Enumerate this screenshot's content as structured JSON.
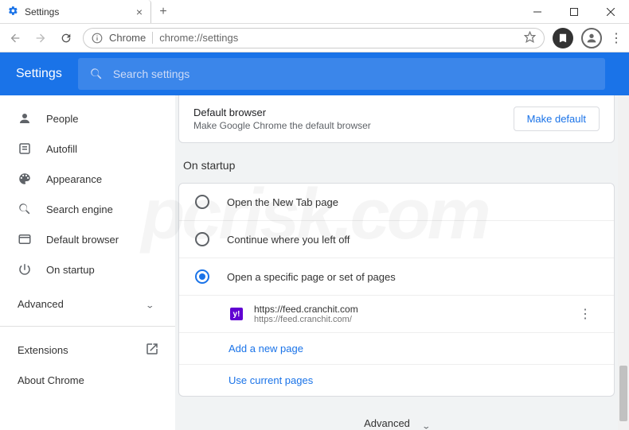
{
  "window": {
    "tab_title": "Settings",
    "new_tab": "+"
  },
  "addressbar": {
    "chrome_label": "Chrome",
    "url": "chrome://settings"
  },
  "header": {
    "title": "Settings",
    "search_placeholder": "Search settings"
  },
  "sidebar": {
    "items": [
      {
        "label": "People"
      },
      {
        "label": "Autofill"
      },
      {
        "label": "Appearance"
      },
      {
        "label": "Search engine"
      },
      {
        "label": "Default browser"
      },
      {
        "label": "On startup"
      }
    ],
    "advanced": "Advanced",
    "extensions": "Extensions",
    "about": "About Chrome"
  },
  "main": {
    "default_browser": {
      "heading": "Default browser",
      "sub": "Make Google Chrome the default browser",
      "button": "Make default"
    },
    "startup": {
      "section": "On startup",
      "options": [
        {
          "label": "Open the New Tab page",
          "selected": false
        },
        {
          "label": "Continue where you left off",
          "selected": false
        },
        {
          "label": "Open a specific page or set of pages",
          "selected": true
        }
      ],
      "page": {
        "title": "https://feed.cranchit.com",
        "url": "https://feed.cranchit.com/"
      },
      "add_new": "Add a new page",
      "use_current": "Use current pages"
    },
    "advanced_footer": "Advanced"
  }
}
